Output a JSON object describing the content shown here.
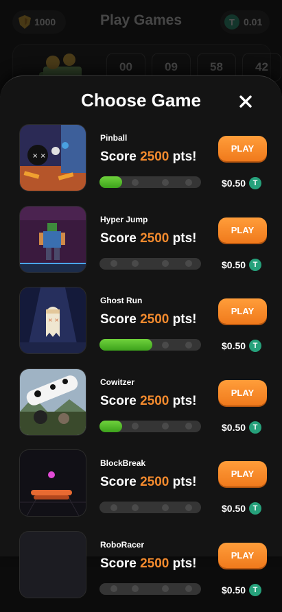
{
  "header": {
    "coins": "1000",
    "title": "Play Games",
    "balance": "0.01",
    "tether_symbol": "T",
    "countdown": [
      "00",
      "09",
      "58",
      "42"
    ]
  },
  "modal": {
    "title": "Choose Game",
    "close_icon": "close-icon"
  },
  "games": [
    {
      "name": "Pinball",
      "score_prefix": "Score",
      "score_value": "2500",
      "score_suffix": "pts!",
      "play_label": "PLAY",
      "price": "$0.50",
      "progress": 0.22
    },
    {
      "name": "Hyper Jump",
      "score_prefix": "Score",
      "score_value": "2500",
      "score_suffix": "pts!",
      "play_label": "PLAY",
      "price": "$0.50",
      "progress": 0
    },
    {
      "name": "Ghost Run",
      "score_prefix": "Score",
      "score_value": "2500",
      "score_suffix": "pts!",
      "play_label": "PLAY",
      "price": "$0.50",
      "progress": 0.52
    },
    {
      "name": "Cowitzer",
      "score_prefix": "Score",
      "score_value": "2500",
      "score_suffix": "pts!",
      "play_label": "PLAY",
      "price": "$0.50",
      "progress": 0.22
    },
    {
      "name": "BlockBreak",
      "score_prefix": "Score",
      "score_value": "2500",
      "score_suffix": "pts!",
      "play_label": "PLAY",
      "price": "$0.50",
      "progress": 0
    },
    {
      "name": "RoboRacer",
      "score_prefix": "Score",
      "score_value": "2500",
      "score_suffix": "pts!",
      "play_label": "PLAY",
      "price": "$0.50",
      "progress": 0
    }
  ],
  "colors": {
    "accent": "#f28a2e",
    "play_button": "#f7892a",
    "progress_fill": "#4cbb26",
    "tether": "#26a17b",
    "modal_bg": "#141414"
  }
}
